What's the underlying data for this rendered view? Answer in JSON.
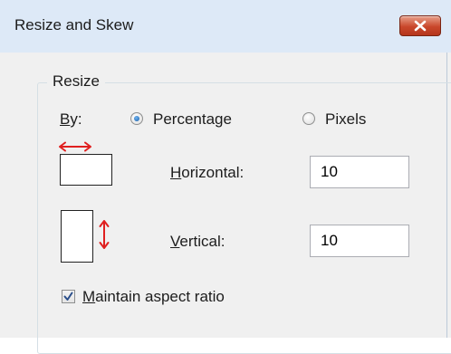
{
  "window": {
    "title": "Resize and Skew"
  },
  "resize_group": {
    "label": "Resize",
    "by_label_u": "B",
    "by_label_rest": "y:",
    "options": [
      {
        "label": "Percentage",
        "selected": true
      },
      {
        "label": "Pixels",
        "selected": false
      }
    ],
    "horizontal": {
      "label_u": "H",
      "label_rest": "orizontal:",
      "value": "10"
    },
    "vertical": {
      "label_u": "V",
      "label_rest": "ertical:",
      "value": "10"
    },
    "maintain_aspect": {
      "label_u": "M",
      "label_rest": "aintain aspect ratio",
      "checked": true
    }
  },
  "colors": {
    "arrow": "#e02020",
    "radio_dot": "#1c5fa8",
    "close_button": "#c9472b"
  },
  "icons": {
    "close": "close-icon",
    "horizontal_arrow": "horizontal-arrow-icon",
    "vertical_arrow": "vertical-arrow-icon",
    "check": "checkmark-icon"
  }
}
